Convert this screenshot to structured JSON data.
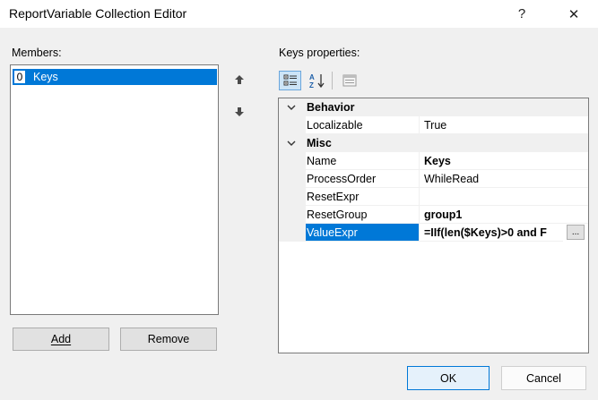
{
  "window": {
    "title": "ReportVariable Collection Editor",
    "help_glyph": "?",
    "close_glyph": "✕"
  },
  "members": {
    "label": "Members:",
    "items": [
      {
        "index": "0",
        "name": "Keys",
        "selected": true
      }
    ],
    "add_label": "Add",
    "remove_label": "Remove"
  },
  "properties": {
    "label": "Keys properties:",
    "toolbar": {
      "categorized_icon": "categorized-icon",
      "alphabetical_icon": "alphabetical-icon",
      "property_pages_icon": "property-pages-icon"
    },
    "categories": [
      {
        "name": "Behavior",
        "rows": [
          {
            "name": "Localizable",
            "value": "True",
            "bold": false
          }
        ]
      },
      {
        "name": "Misc",
        "rows": [
          {
            "name": "Name",
            "value": "Keys",
            "bold": true
          },
          {
            "name": "ProcessOrder",
            "value": "WhileRead",
            "bold": false
          },
          {
            "name": "ResetExpr",
            "value": "",
            "bold": false
          },
          {
            "name": "ResetGroup",
            "value": "group1",
            "bold": true
          },
          {
            "name": "ValueExpr",
            "value": "=IIf(len($Keys)>0 and F",
            "bold": true,
            "selected": true,
            "ellipsis": "..."
          }
        ]
      }
    ]
  },
  "footer": {
    "ok_label": "OK",
    "cancel_label": "Cancel"
  },
  "colors": {
    "selection": "#0078d7",
    "window_bg": "#f0f0f0"
  }
}
